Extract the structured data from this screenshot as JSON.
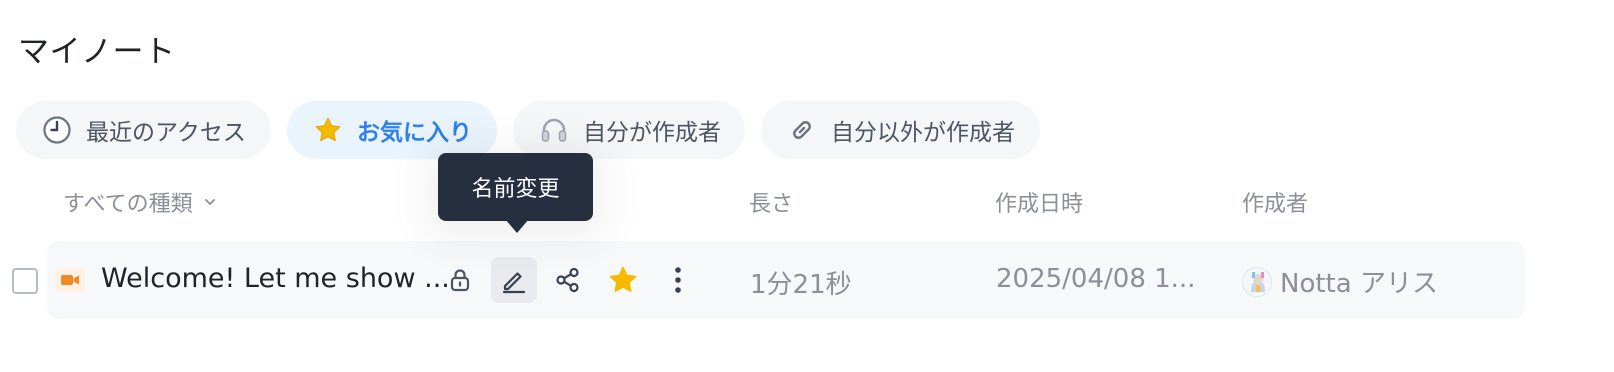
{
  "page": {
    "title": "マイノート"
  },
  "filters": [
    {
      "label": "最近のアクセス",
      "icon": "clock-icon",
      "active": false
    },
    {
      "label": "お気に入り",
      "icon": "star-icon",
      "active": true
    },
    {
      "label": "自分が作成者",
      "icon": "headphones-icon",
      "active": false
    },
    {
      "label": "自分以外が作成者",
      "icon": "link-icon",
      "active": false
    }
  ],
  "table": {
    "type_filter": "すべての種類",
    "columns": {
      "length": "長さ",
      "created": "作成日時",
      "author": "作成者"
    }
  },
  "tooltip": {
    "text": "名前変更"
  },
  "rows": [
    {
      "title": "Welcome! Let me show ...",
      "type_icon": "video-camera-icon",
      "length": "1分21秒",
      "created": "2025/04/08 1...",
      "author": "Notta アリス",
      "favorite": true
    }
  ],
  "colors": {
    "accent": "#2f80ed",
    "star": "#f5b900",
    "video": "#f08a24",
    "tooltip_bg": "#252f3f"
  }
}
